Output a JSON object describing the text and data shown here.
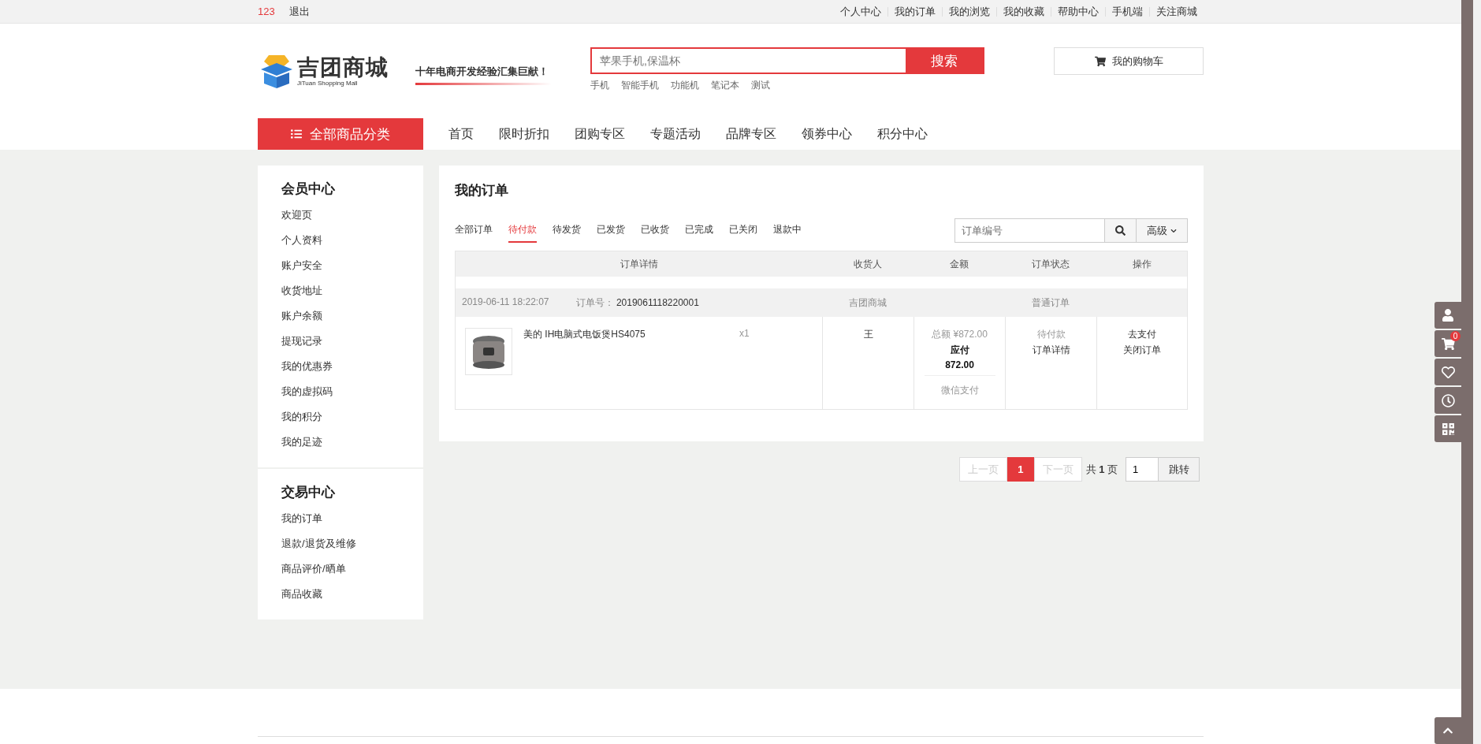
{
  "top_bar": {
    "username": "123",
    "logout": "退出",
    "links": [
      "个人中心",
      "我的订单",
      "我的浏览",
      "我的收藏",
      "帮助中心",
      "手机端",
      "关注商城"
    ]
  },
  "header": {
    "logo": {
      "name": "吉团商城",
      "subtitle": "JiTuan Shopping Mall"
    },
    "slogan": "十年电商开发经验汇集巨献！",
    "search": {
      "placeholder": "苹果手机,保温杯",
      "button": "搜索"
    },
    "hot_words": [
      "手机",
      "智能手机",
      "功能机",
      "笔记本",
      "测试"
    ],
    "cart_button": "我的购物车"
  },
  "nav": {
    "category_button": "全部商品分类",
    "items": [
      "首页",
      "限时折扣",
      "团购专区",
      "专题活动",
      "品牌专区",
      "领券中心",
      "积分中心"
    ]
  },
  "sidebar": {
    "sections": [
      {
        "title": "会员中心",
        "items": [
          "欢迎页",
          "个人资料",
          "账户安全",
          "收货地址",
          "账户余额",
          "提现记录",
          "我的优惠券",
          "我的虚拟码",
          "我的积分",
          "我的足迹"
        ]
      },
      {
        "title": "交易中心",
        "items": [
          "我的订单",
          "退款/退货及维修",
          "商品评价/晒单",
          "商品收藏"
        ]
      }
    ]
  },
  "orders": {
    "title": "我的订单",
    "tabs": [
      {
        "label": "全部订单",
        "selected": false
      },
      {
        "label": "待付款",
        "selected": true
      },
      {
        "label": "待发货",
        "selected": false
      },
      {
        "label": "已发货",
        "selected": false
      },
      {
        "label": "已收货",
        "selected": false
      },
      {
        "label": "已完成",
        "selected": false
      },
      {
        "label": "已关闭",
        "selected": false
      },
      {
        "label": "退款中",
        "selected": false
      }
    ],
    "search": {
      "placeholder": "订单编号",
      "advanced": "高级"
    },
    "columns": [
      "订单详情",
      "收货人",
      "金额",
      "订单状态",
      "操作"
    ],
    "rows": [
      {
        "time": "2019-06-11 18:22:07",
        "number_label": "订单号：",
        "number": "2019061118220001",
        "shop": "吉团商城",
        "order_type": "普通订单",
        "product": "美的 IH电脑式电饭煲HS4075",
        "quantity": "x1",
        "receiver": "王",
        "total": "总额 ¥872.00",
        "payable_label": "应付",
        "payable": "872.00",
        "payment": "微信支付",
        "status": "待付款",
        "detail_link": "订单详情",
        "actions": [
          "去支付",
          "关闭订单"
        ]
      }
    ]
  },
  "pagination": {
    "prev": "上一页",
    "pages": [
      {
        "label": "1",
        "selected": true
      }
    ],
    "next": "下一页",
    "total_prefix": "共",
    "total": "1",
    "total_suffix": "页",
    "jump_value": "1",
    "jump_button": "跳转"
  },
  "right_toolbar": {
    "cart_count": "0"
  }
}
